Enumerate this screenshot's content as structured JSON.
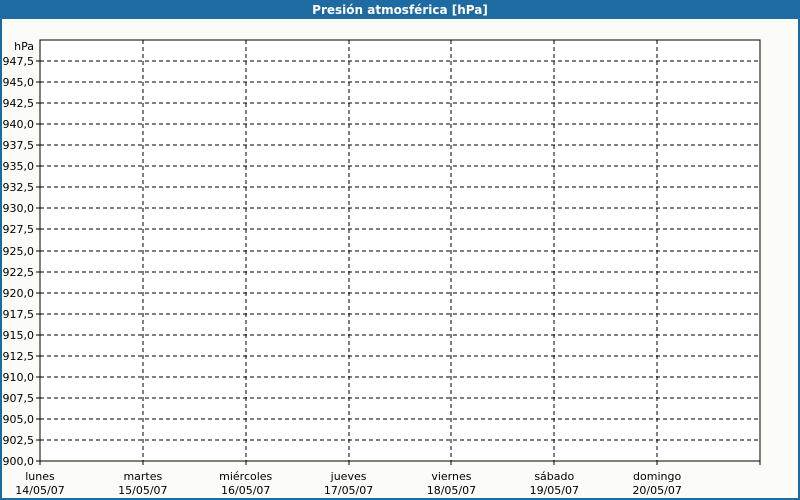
{
  "window": {
    "title": "Presión atmosférica [hPa]"
  },
  "colors": {
    "titlebar_bg": "#1E6BA2",
    "titlebar_text": "#FFFFFF",
    "frame_border": "#1E6BA2",
    "page_bg": "#FBFCF8",
    "plot_bg": "#FFFFFF",
    "grid_line": "#000000",
    "axis_line": "#000000",
    "label_text": "#000000"
  },
  "chart_data": {
    "type": "line",
    "title": "Presión atmosférica [hPa]",
    "ylabel": "hPa",
    "y_axis": {
      "unit": "hPa",
      "min": 900,
      "max": 950,
      "tick_step": 2.5,
      "tick_values": [
        947.5,
        945.0,
        942.5,
        940.0,
        937.5,
        935.0,
        932.5,
        930.0,
        927.5,
        925.0,
        922.5,
        920.0,
        917.5,
        915.0,
        912.5,
        910.0,
        907.5,
        905.0,
        902.5,
        900.0
      ],
      "tick_labels": [
        "947,5",
        "945,0",
        "942,5",
        "940,0",
        "937,5",
        "935,0",
        "932,5",
        "930,0",
        "927,5",
        "925,0",
        "922,5",
        "920,0",
        "917,5",
        "915,0",
        "912,5",
        "910,0",
        "907,5",
        "905,0",
        "902,5",
        "900,0"
      ]
    },
    "x_axis": {
      "intervals": 7,
      "categories": [
        {
          "day": "lunes",
          "date": "14/05/07"
        },
        {
          "day": "martes",
          "date": "15/05/07"
        },
        {
          "day": "miércoles",
          "date": "16/05/07"
        },
        {
          "day": "jueves",
          "date": "17/05/07"
        },
        {
          "day": "viernes",
          "date": "18/05/07"
        },
        {
          "day": "sábado",
          "date": "19/05/07"
        },
        {
          "day": "domingo",
          "date": "20/05/07"
        }
      ]
    },
    "series": [],
    "grid": {
      "style": "dashed",
      "horizontal": true,
      "vertical": true,
      "legend": "none"
    }
  }
}
